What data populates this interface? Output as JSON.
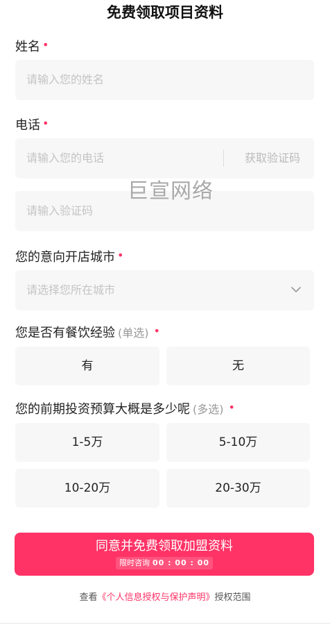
{
  "title": "免费领取项目资料",
  "required_mark": "•",
  "fields": {
    "name": {
      "label": "姓名",
      "placeholder": "请输入您的姓名"
    },
    "phone": {
      "label": "电话",
      "placeholder": "请输入您的电话",
      "get_code": "获取验证码"
    },
    "code": {
      "placeholder": "请输入验证码"
    },
    "city": {
      "label": "您的意向开店城市",
      "placeholder": "请选择您所在城市"
    },
    "experience": {
      "label": "您是否有餐饮经验",
      "hint": "(单选)",
      "options": [
        "有",
        "无"
      ]
    },
    "budget": {
      "label": "您的前期投资预算大概是多少呢",
      "hint": "(多选)",
      "options": [
        "1-5万",
        "5-10万",
        "10-20万",
        "20-30万"
      ]
    }
  },
  "watermark": "巨宣网络",
  "submit": {
    "label": "同意并免费领取加盟资料",
    "sub_label": "限时咨询",
    "timer": "00 : 00 : 00"
  },
  "consent": {
    "prefix": "查看",
    "link": "《个人信息授权与保护声明》",
    "suffix": "授权范围"
  },
  "colors": {
    "accent": "#ff3366",
    "input_bg": "#f7f7f7",
    "placeholder": "#c4c4c4"
  },
  "icons": {
    "city_select": "chevron-down-icon"
  }
}
